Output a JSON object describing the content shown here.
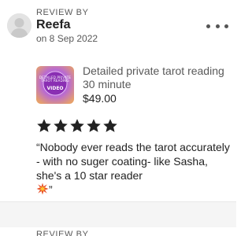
{
  "review": {
    "label": "REVIEW BY",
    "reviewer": "Reefa",
    "date": "on 8 Sep 2022",
    "menu_icon": "more-horizontal-icon",
    "product": {
      "thumbnail_caption_small": "DETAILED PRIVATE TAROT READING",
      "thumbnail_caption_large": "VIDEO",
      "title": "Detailed private tarot reading 30 minute",
      "price": "$49.00"
    },
    "rating": {
      "stars": 5,
      "max": 5,
      "star_icon": "star-icon"
    },
    "text": "“Nobody ever reads the tarot accurately - with no suger coating- like Sasha, she's a 10 star reader",
    "text_end": "”"
  },
  "next_review": {
    "label": "REVIEW BY"
  },
  "colors": {
    "text_primary": "#222222",
    "text_secondary": "#595959",
    "divider_background": "#f5f5f5",
    "star": "#222222"
  }
}
